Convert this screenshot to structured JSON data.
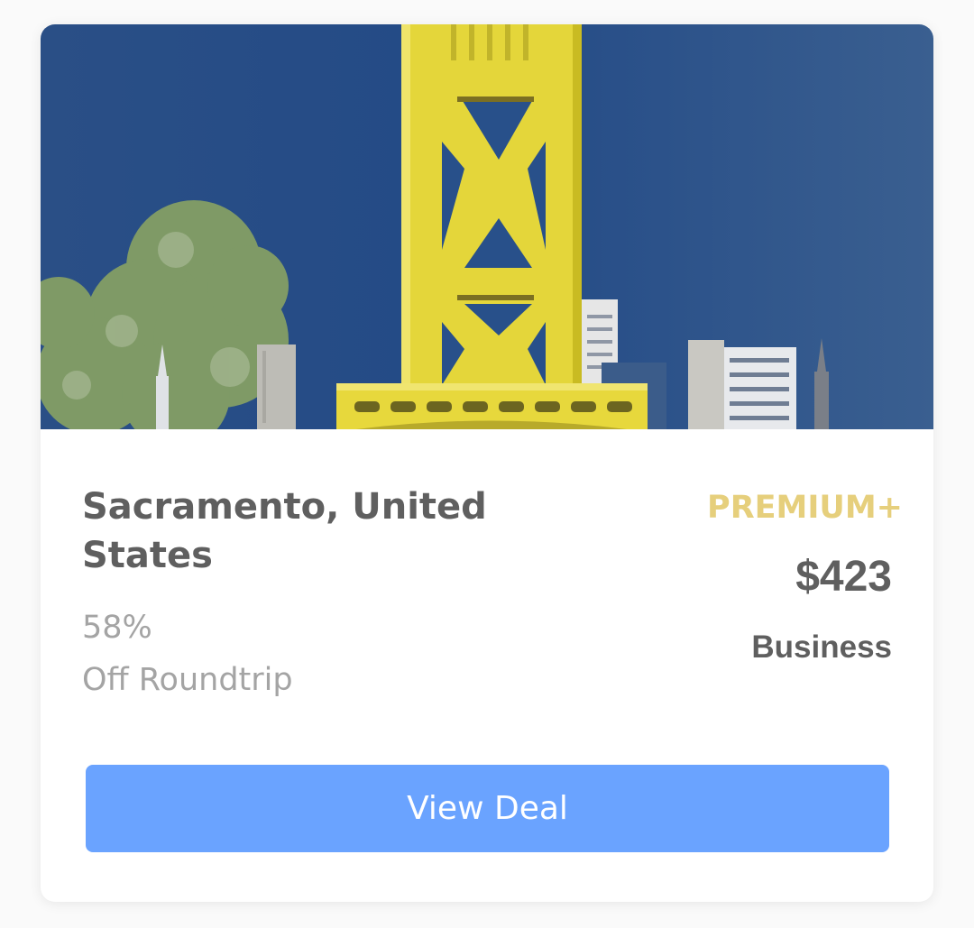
{
  "deal": {
    "destination": "Sacramento, United States",
    "discount_percent": "58%",
    "discount_label": "Off Roundtrip",
    "tier": "PREMIUM+",
    "price": "$423",
    "cabin_class": "Business",
    "cta_label": "View Deal"
  },
  "hero_image": {
    "subject": "Tower Bridge, Sacramento",
    "sky_color": "#2f5487",
    "tower_color": "#e4d63a"
  },
  "colors": {
    "title": "#5f5f5f",
    "muted": "#a4a4a4",
    "tier": "#e6cf7c",
    "button": "#6aa3ff",
    "button_text": "#ffffff"
  }
}
